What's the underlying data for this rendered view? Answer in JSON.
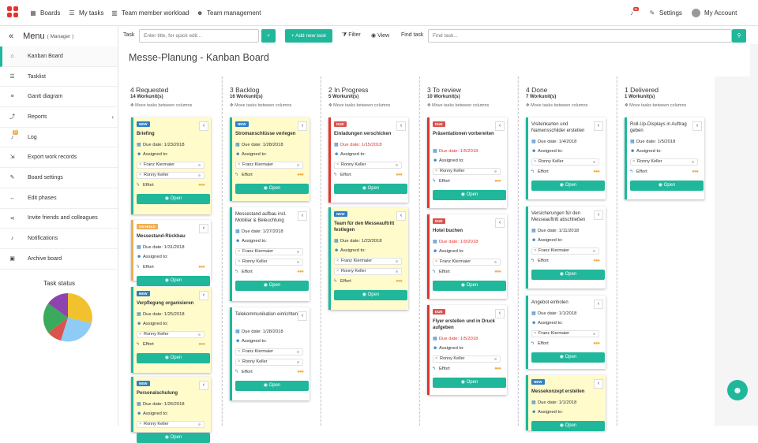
{
  "topnav": {
    "items": [
      {
        "label": "Boards",
        "icon": "grid-icon"
      },
      {
        "label": "My tasks",
        "icon": "list-icon"
      },
      {
        "label": "Team member workload",
        "icon": "bar-chart-icon"
      },
      {
        "label": "Team management",
        "icon": "team-icon"
      }
    ],
    "notifications_count": "11",
    "settings_label": "Settings",
    "account_label": "My Account"
  },
  "sidebar": {
    "title": "Menu",
    "subtitle": "( Manager )",
    "items": [
      {
        "label": "Kanban Board",
        "icon": "home-icon"
      },
      {
        "label": "Tasklist",
        "icon": "list-icon"
      },
      {
        "label": "Gantt diagram",
        "icon": "sliders-icon"
      },
      {
        "label": "Reports",
        "icon": "line-chart-icon"
      },
      {
        "label": "Log",
        "icon": "bell-icon",
        "badge": "0"
      },
      {
        "label": "Export work records",
        "icon": "export-icon"
      },
      {
        "label": "Board settings",
        "icon": "wrench-icon"
      },
      {
        "label": "Edit phases",
        "icon": "arrows-icon"
      },
      {
        "label": "Invite friends and colleagues",
        "icon": "share-icon"
      },
      {
        "label": "Notifications",
        "icon": "bell-icon"
      },
      {
        "label": "Archive board",
        "icon": "archive-icon"
      }
    ],
    "task_status_label": "Task status",
    "pie_colors": [
      "#f2c12e",
      "#8ecbf5",
      "#d9534f",
      "#3aaa5c",
      "#8e44ad"
    ]
  },
  "toolbar": {
    "task_label": "Task",
    "task_placeholder": "Enter title, for quick edit...",
    "add_plus": "+",
    "add_new_task": "+ Add new task",
    "filter_label": "Filter",
    "view_label": "View",
    "find_label": "Find task",
    "find_placeholder": "Find task..."
  },
  "page_title": "Messe-Planung - Kanban Board",
  "move_hint": "✥ Move tasks between columns",
  "open_label": "Open",
  "due_prefix": "Due date: ",
  "assigned_label": "Assigned to:",
  "effort_label": "Effort",
  "columns": [
    {
      "title": "4 Requested",
      "count": "14 Workunit(s)"
    },
    {
      "title": "3 Backlog",
      "count": "16 Workunit(s)"
    },
    {
      "title": "2 In Progress",
      "count": "5 Workunit(s)"
    },
    {
      "title": "3 To review",
      "count": "10 Workunit(s)"
    },
    {
      "title": "4 Done",
      "count": "7 Workunit(s)"
    },
    {
      "title": "1 Delivered",
      "count": "1 Workunit(s)"
    }
  ],
  "cards": {
    "c0_0": {
      "tag": "NEW",
      "title": "Briefing",
      "due": "1/23/2018",
      "people": [],
      "dots": "●●●"
    },
    "c0_1": {
      "tag": "ON HOLD",
      "title": "Messestand-Rückbau",
      "due": "1/31/2018",
      "dots": "●●●"
    },
    "c0_2": {
      "tag": "NEW",
      "title": "Verpflegung organisieren",
      "due": "1/25/2018",
      "people": [
        "Ronny Keller"
      ],
      "dots": "●●●"
    },
    "c0_3": {
      "tag": "NEW",
      "title": "Personalschulung",
      "due": "1/26/2018",
      "people": [
        "Ronny Keller"
      ]
    },
    "c1_0": {
      "tag": "NEW",
      "title": "Stromanschlüsse verlegen",
      "due": "1/28/2018",
      "people": [
        "Franz Kiermaier"
      ],
      "dots": "●●●"
    },
    "c1_1": {
      "title": "Messestand aufbau incl. Mobiliar & Beleuchtung",
      "due": "1/27/2018",
      "people": [
        "Franz Kiermaier",
        "Ronny Keller"
      ],
      "dots": "●●●"
    },
    "c1_2": {
      "title": "Telekommunikation einrichten",
      "due": "1/28/2018",
      "people": [
        "Franz Kiermaier",
        "Ronny Keller"
      ],
      "dots": "●●●"
    },
    "c2_0": {
      "tag": "DUE",
      "title": "Einladungen verschicken",
      "due": "1/15/2018",
      "people": [
        "Ronny Keller"
      ],
      "dots": "●●●"
    },
    "c2_1": {
      "tag": "NEW",
      "title": "Team für den Messeauftritt festlegen",
      "due": "1/23/2018",
      "people": [
        "Franz Kiermaier",
        "Ronny Keller"
      ],
      "dots": "●●●"
    },
    "c3_0": {
      "tag": "DUE",
      "title": "Präsentationen vorbereiten",
      "due": "1/5/2018",
      "people": [
        "Ronny Keller"
      ],
      "dots": "●●●"
    },
    "c3_1": {
      "tag": "DUE",
      "title": "Hotel buchen",
      "due": "1/9/2018",
      "people": [
        "Franz Kiermaier"
      ],
      "dots": "●●●"
    },
    "c3_2": {
      "tag": "DUE",
      "title": "Flyer erstellen und in Druck aufgeben",
      "due": "1/5/2018",
      "people": [
        "Ronny Keller"
      ],
      "dots": "●●●"
    },
    "c4_0": {
      "title": "Visitenkarten und Namensschilder erstellen",
      "due": "1/4/2018",
      "people": [
        "Ronny Keller"
      ],
      "dots": "●●●"
    },
    "c4_1": {
      "title": "Versicherungen für den Messeauftritt abschließen",
      "due": "1/11/2018",
      "people": [
        "Franz Kiermaier"
      ],
      "dots": "●●●"
    },
    "c4_2": {
      "title": "Angebot einholen",
      "due": "1/1/2018",
      "people": [
        "Franz Kiermaier"
      ],
      "dots": "●●●"
    },
    "c4_3": {
      "tag": "NEW",
      "title": "Messekonzept erstellen",
      "due": "1/1/2018"
    },
    "c5_0": {
      "title": "Roll-Up-Displays in Auftrag geben",
      "due": "1/5/2018",
      "people": [
        "Ronny Keller"
      ],
      "dots": "●●●"
    }
  },
  "briefing_people": [
    "Franz Kiermaier",
    "Ronny Keller"
  ]
}
